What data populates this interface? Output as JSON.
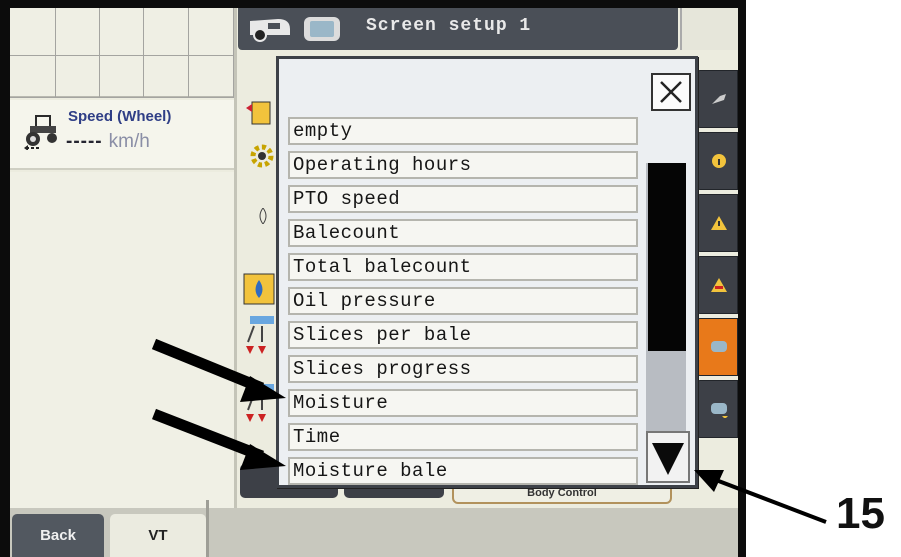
{
  "screen": {
    "title": "Screen setup 1",
    "speed_label": "Speed (Wheel)",
    "speed_value": "-----",
    "speed_unit": "km/h"
  },
  "dialog": {
    "close_icon": "close-icon",
    "options": [
      "empty",
      "Operating hours",
      "PTO speed",
      "Balecount",
      "Total balecount",
      "Oil pressure",
      "Slices per bale",
      "Slices progress",
      "Moisture",
      "Time",
      "Moisture bale"
    ],
    "scroll_down_icon": "scroll-down-icon"
  },
  "bottom": {
    "back_tab": "Back",
    "vt_tab": "VT",
    "body_control": "Body Control"
  },
  "softkeys": [
    "tool-icon",
    "info-icon",
    "warning-icon",
    "alarm-icon",
    "terminal-1-icon",
    "terminal-2-icon"
  ],
  "annotation": {
    "callout_number": "15"
  },
  "colors": {
    "bezel": "#0c0c0c",
    "titlebar": "#4a4f57",
    "softkey": "#3d4047",
    "softkey_active": "#e8791a",
    "speed_label": "#2f3e86"
  }
}
